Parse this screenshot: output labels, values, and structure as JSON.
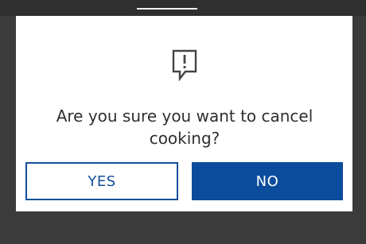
{
  "dialog": {
    "message": "Are you sure you want to cancel\ncooking?",
    "icon": "alert-speech-bubble-icon"
  },
  "buttons": {
    "yes_label": "YES",
    "no_label": "NO"
  },
  "colors": {
    "accent": "#124f99",
    "primary_button": "#0c4c9c",
    "overlay": "#3b3b3b",
    "dialog_background": "#ffffff",
    "text": "#2f2f2f"
  }
}
